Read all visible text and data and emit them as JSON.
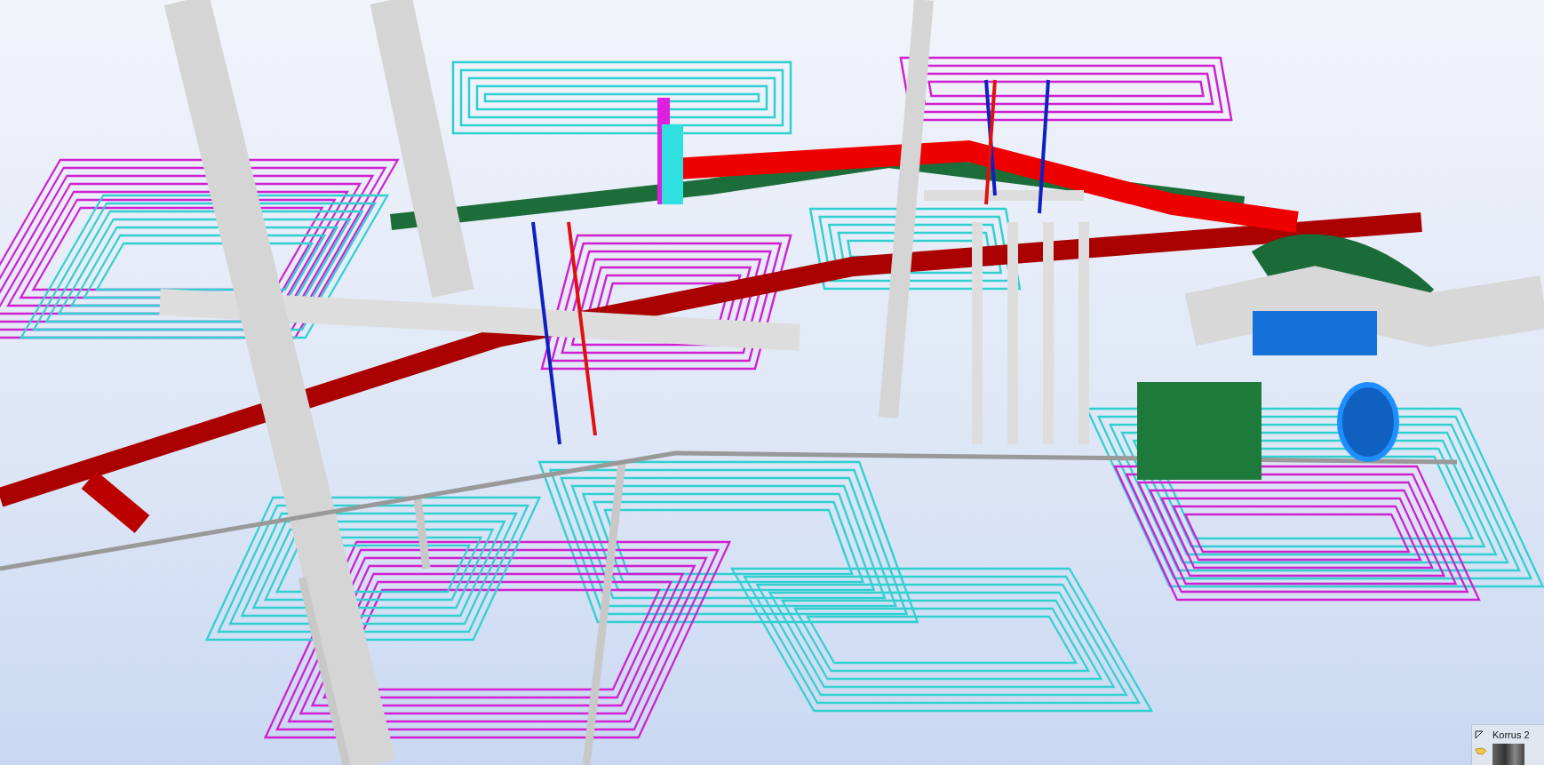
{
  "storey_widget": {
    "label": "Korrus 2"
  }
}
